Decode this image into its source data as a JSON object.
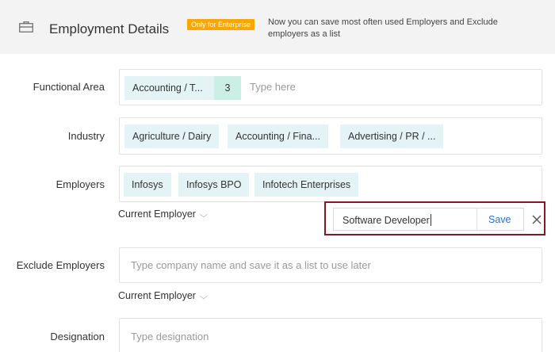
{
  "header": {
    "title": "Employment Details",
    "badge": "Only for Enterprise",
    "note": "Now you can save most often used Employers and Exclude employers as a list"
  },
  "functional_area": {
    "label": "Functional Area",
    "chips": [
      "Accounting / T..."
    ],
    "more_count": "3",
    "placeholder": "Type here"
  },
  "industry": {
    "label": "Industry",
    "chips": [
      "Agriculture / Dairy",
      "Accounting / Fina...",
      "Advertising / PR / ..."
    ]
  },
  "employers": {
    "label": "Employers",
    "chips": [
      "Infosys",
      "Infosys BPO",
      "Infotech Enterprises"
    ],
    "filter": "Current Employer"
  },
  "save_list_popup": {
    "value": "Software Developer",
    "save_label": "Save",
    "close_glyph": "✕"
  },
  "exclude_employers": {
    "label": "Exclude Employers",
    "placeholder": "Type company name and save it as a list to use later",
    "filter": "Current Employer"
  },
  "designation": {
    "label": "Designation",
    "placeholder": "Type designation"
  }
}
